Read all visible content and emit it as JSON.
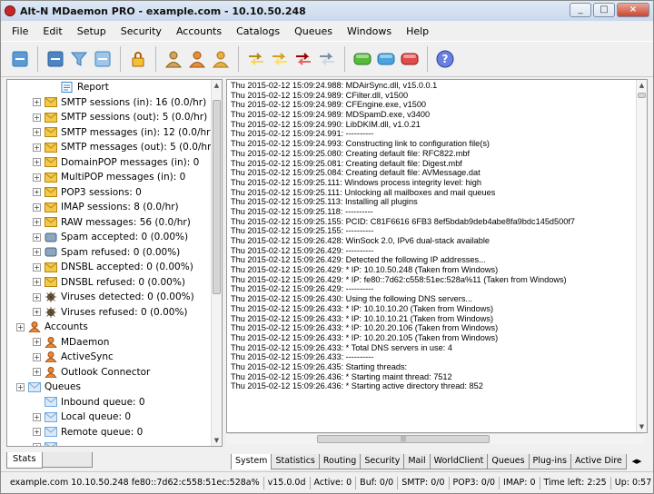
{
  "window": {
    "title": "Alt-N MDaemon PRO - example.com - 10.10.50.248"
  },
  "menu": [
    "File",
    "Edit",
    "Setup",
    "Security",
    "Accounts",
    "Catalogs",
    "Queues",
    "Windows",
    "Help"
  ],
  "toolbar_icons": [
    "refresh-icon",
    "satellite-icon",
    "filter-icon",
    "search-log-icon",
    "lock-icon",
    "user-search-icon",
    "user-icon",
    "users-icon",
    "arrows-yellow-icon",
    "arrows-sun-icon",
    "arrows-red-icon",
    "arrows-exchange-icon",
    "status-green-icon",
    "status-blue-icon",
    "status-red-icon",
    "help-icon"
  ],
  "tree": [
    {
      "indent": 2,
      "icon": "report-icon",
      "label": "Report",
      "exp": false
    },
    {
      "indent": 1,
      "icon": "mail-icon",
      "label": "SMTP sessions (in): 16  (0.0/hr)",
      "exp": true
    },
    {
      "indent": 1,
      "icon": "mail-icon",
      "label": "SMTP sessions (out): 5  (0.0/hr)",
      "exp": true
    },
    {
      "indent": 1,
      "icon": "mail-icon",
      "label": "SMTP messages (in): 12  (0.0/hr)",
      "exp": true
    },
    {
      "indent": 1,
      "icon": "mail-icon",
      "label": "SMTP messages (out): 5  (0.0/hr)",
      "exp": true
    },
    {
      "indent": 1,
      "icon": "mail-icon",
      "label": "DomainPOP messages (in): 0",
      "exp": true
    },
    {
      "indent": 1,
      "icon": "mail-icon",
      "label": "MultiPOP messages (in): 0",
      "exp": true
    },
    {
      "indent": 1,
      "icon": "mail-icon",
      "label": "POP3 sessions: 0",
      "exp": true
    },
    {
      "indent": 1,
      "icon": "mail-icon",
      "label": "IMAP sessions: 8  (0.0/hr)",
      "exp": true
    },
    {
      "indent": 1,
      "icon": "mail-icon",
      "label": "RAW messages: 56  (0.0/hr)",
      "exp": true
    },
    {
      "indent": 1,
      "icon": "spam-icon",
      "label": "Spam accepted: 0  (0.00%)",
      "exp": true
    },
    {
      "indent": 1,
      "icon": "spam-icon",
      "label": "Spam refused: 0  (0.00%)",
      "exp": true
    },
    {
      "indent": 1,
      "icon": "mail-icon",
      "label": "DNSBL accepted: 0  (0.00%)",
      "exp": true
    },
    {
      "indent": 1,
      "icon": "mail-icon",
      "label": "DNSBL refused: 0  (0.00%)",
      "exp": true
    },
    {
      "indent": 1,
      "icon": "virus-icon",
      "label": "Viruses detected: 0  (0.00%)",
      "exp": true
    },
    {
      "indent": 1,
      "icon": "virus-icon",
      "label": "Viruses refused: 0  (0.00%)",
      "exp": true
    },
    {
      "indent": 0,
      "icon": "user-icon",
      "label": "Accounts",
      "exp": true
    },
    {
      "indent": 1,
      "icon": "user-icon",
      "label": "MDaemon",
      "exp": true
    },
    {
      "indent": 1,
      "icon": "user-icon",
      "label": "ActiveSync",
      "exp": true
    },
    {
      "indent": 1,
      "icon": "user-icon",
      "label": "Outlook Connector",
      "exp": true
    },
    {
      "indent": 0,
      "icon": "queue-icon",
      "label": "Queues",
      "exp": true
    },
    {
      "indent": 1,
      "icon": "queue-icon",
      "label": "Inbound queue: 0",
      "exp": false
    },
    {
      "indent": 1,
      "icon": "queue-icon",
      "label": "Local queue: 0",
      "exp": true
    },
    {
      "indent": 1,
      "icon": "queue-icon",
      "label": "Remote queue: 0",
      "exp": true
    },
    {
      "indent": 1,
      "icon": "queue-icon",
      "label": "",
      "exp": true
    }
  ],
  "log": [
    "Thu 2015-02-12 15:09:24.988: MDAirSync.dll, v15.0.0.1",
    "Thu 2015-02-12 15:09:24.989: CFilter.dll, v1500",
    "Thu 2015-02-12 15:09:24.989: CFEngine.exe, v1500",
    "Thu 2015-02-12 15:09:24.989: MDSpamD.exe, v3400",
    "Thu 2015-02-12 15:09:24.990: LibDKIM.dll, v1.0.21",
    "Thu 2015-02-12 15:09:24.991: ----------",
    "Thu 2015-02-12 15:09:24.993: Constructing link to configuration file(s)",
    "Thu 2015-02-12 15:09:25.080: Creating default file: RFC822.mbf",
    "Thu 2015-02-12 15:09:25.081: Creating default file: Digest.mbf",
    "Thu 2015-02-12 15:09:25.084: Creating default file: AVMessage.dat",
    "Thu 2015-02-12 15:09:25.111: Windows process integrity level: high",
    "Thu 2015-02-12 15:09:25.111: Unlocking all mailboxes and mail queues",
    "Thu 2015-02-12 15:09:25.113: Installing all plugins",
    "Thu 2015-02-12 15:09:25.118: ----------",
    "Thu 2015-02-12 15:09:25.155: PCID: C81F6616 6FB3 8ef5bdab9deb4abe8fa9bdc145d500f7",
    "Thu 2015-02-12 15:09:25.155: ----------",
    "Thu 2015-02-12 15:09:26.428: WinSock 2.0, IPv6 dual-stack available",
    "Thu 2015-02-12 15:09:26.429: ----------",
    "Thu 2015-02-12 15:09:26.429: Detected the following IP addresses...",
    "Thu 2015-02-12 15:09:26.429: *  IP:  10.10.50.248  (Taken from Windows)",
    "Thu 2015-02-12 15:09:26.429: *  IP:  fe80::7d62:c558:51ec:528a%11  (Taken from Windows)",
    "Thu 2015-02-12 15:09:26.429: ----------",
    "Thu 2015-02-12 15:09:26.430: Using the following DNS servers...",
    "Thu 2015-02-12 15:09:26.433: *  IP:  10.10.10.20  (Taken from Windows)",
    "Thu 2015-02-12 15:09:26.433: *  IP:  10.10.10.21  (Taken from Windows)",
    "Thu 2015-02-12 15:09:26.433: *  IP:  10.20.20.106  (Taken from Windows)",
    "Thu 2015-02-12 15:09:26.433: *  IP:  10.20.20.105  (Taken from Windows)",
    "Thu 2015-02-12 15:09:26.433: *  Total DNS servers in use: 4",
    "Thu 2015-02-12 15:09:26.433: ----------",
    "Thu 2015-02-12 15:09:26.435: Starting threads:",
    "Thu 2015-02-12 15:09:26.436: *  Starting maint thread: 7512",
    "Thu 2015-02-12 15:09:26.436: *  Starting active directory thread: 852"
  ],
  "left_tabs": [
    {
      "label": "Stats",
      "active": true
    },
    {
      "label": "",
      "active": false
    }
  ],
  "log_tabs": [
    {
      "label": "System",
      "active": true
    },
    {
      "label": "Statistics",
      "active": false
    },
    {
      "label": "Routing",
      "active": false
    },
    {
      "label": "Security",
      "active": false
    },
    {
      "label": "Mail",
      "active": false
    },
    {
      "label": "WorldClient",
      "active": false
    },
    {
      "label": "Queues",
      "active": false
    },
    {
      "label": "Plug-ins",
      "active": false
    },
    {
      "label": "Active Dire",
      "active": false
    }
  ],
  "status": [
    "example.com  10.10.50.248  fe80::7d62:c558:51ec:528a%",
    "v15.0.0d",
    "Active: 0",
    "Buf: 0/0",
    "SMTP: 0/0",
    "POP3: 0/0",
    "IMAP: 0",
    "Time left: 2:25",
    "Up: 0:57"
  ],
  "colors": {
    "mail": "#f2c94c",
    "user": "#e8883a",
    "queue": "#6fa8dc",
    "spam": "#8aa6c1",
    "virus": "#8b7355"
  }
}
